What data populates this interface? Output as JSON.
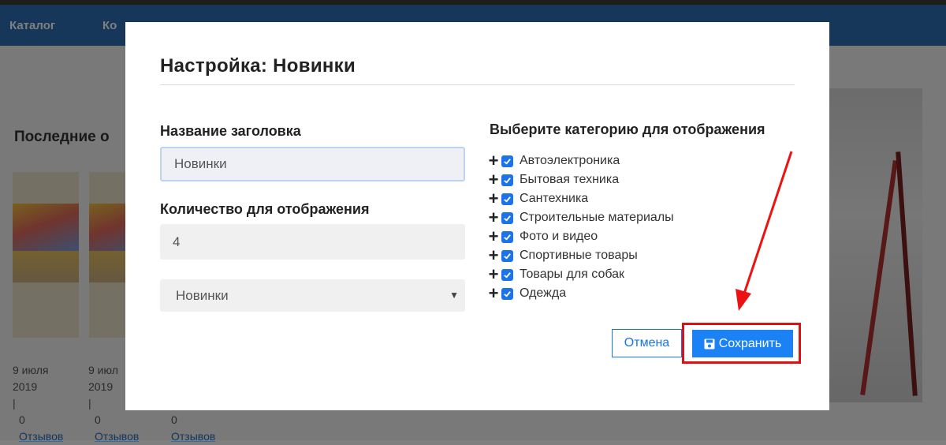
{
  "background": {
    "nav": [
      "Каталог",
      "Ко"
    ],
    "section_title": "Последние о",
    "cards": [
      {
        "date_day": "9 июля",
        "date_year": "2019",
        "sep": "|",
        "count": "0",
        "reviews": "Отзывов"
      },
      {
        "date_day": "9 июл",
        "date_year": "2019",
        "sep": "|",
        "count": "0",
        "reviews": "Отзывов"
      },
      {
        "count": "0",
        "reviews": "Отзывов"
      }
    ]
  },
  "modal": {
    "title": "Настройка: Новинки",
    "heading_label": "Название заголовка",
    "heading_value": "Новинки",
    "quantity_label": "Количество для отображения",
    "quantity_value": "4",
    "select_value": "Новинки",
    "categories_heading": "Выберите категорию для отображения",
    "categories": [
      "Автоэлектроника",
      "Бытовая техника",
      "Сантехника",
      "Строительные материалы",
      "Фото и видео",
      "Спортивные товары",
      "Товары для собак",
      "Одежда"
    ],
    "cancel_label": "Отмена",
    "save_label": "Сохранить"
  },
  "colors": {
    "accent": "#1a82f5",
    "highlight": "#e01010",
    "nav": "#2d6fb3"
  }
}
